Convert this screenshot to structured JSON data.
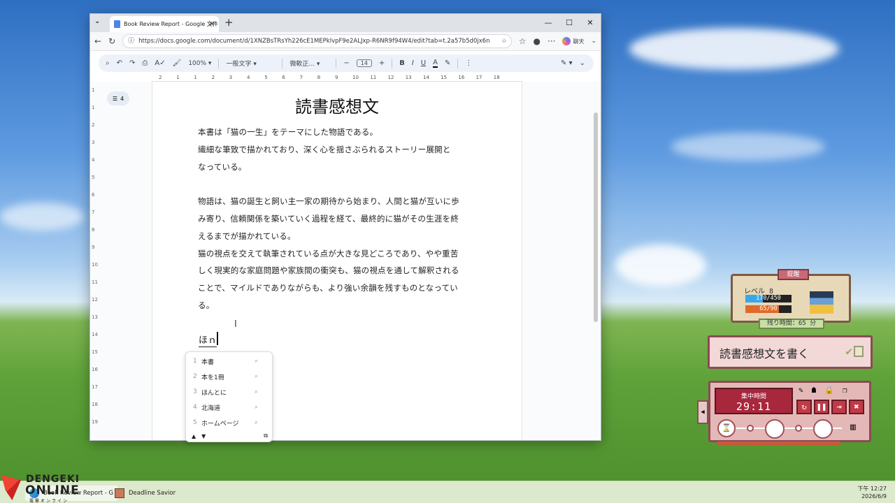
{
  "browser": {
    "tab_title": "Book Review Report - Google 文件",
    "url": "https://docs.google.com/document/d/1XNZBsTRsYh226cE1MEPklvpF9e2ALJxp-R6NR9f94W4/edit?tab=t.2a57b5d0jx6n",
    "chat_label": "聊天"
  },
  "toolbar": {
    "zoom": "100%",
    "style": "一般文字",
    "font": "微軟正...",
    "font_size": "14"
  },
  "outline_count": "4",
  "ruler_labels": [
    "2",
    "1",
    "1",
    "2",
    "3",
    "4",
    "5",
    "6",
    "7",
    "8",
    "9",
    "10",
    "11",
    "12",
    "13",
    "14",
    "15",
    "16",
    "17",
    "18"
  ],
  "vruler_labels": [
    "1",
    "1",
    "2",
    "3",
    "4",
    "5",
    "6",
    "7",
    "8",
    "9",
    "10",
    "11",
    "12",
    "13",
    "14",
    "15",
    "16",
    "17",
    "18",
    "19"
  ],
  "document": {
    "title": "読書感想文",
    "lines": [
      "本書は「猫の一生」をテーマにした物語である。",
      "繊細な筆致で描かれており、深く心を揺さぶられるストーリー展開と",
      "なっている。",
      "",
      "物語は、猫の誕生と飼い主一家の期待から始まり、人間と猫が互いに歩",
      "み寄り、信頼関係を築いていく過程を経て、最終的に猫がその生涯を終",
      "えるまでが描かれている。",
      "猫の視点を交えて執筆されている点が大きな見どころであり、やや重苦",
      "しく現実的な家庭問題や家族間の衝突も、猫の視点を通して解釈される",
      "ことで、マイルドでありながらも、より強い余韻を残すものとなってい",
      "る。"
    ],
    "typing": "ほｎ"
  },
  "ime_candidates": [
    {
      "num": "1",
      "text": "本書"
    },
    {
      "num": "2",
      "text": "本を1冊"
    },
    {
      "num": "3",
      "text": "ほんとに"
    },
    {
      "num": "4",
      "text": "北海道"
    },
    {
      "num": "5",
      "text": "ホームページ"
    }
  ],
  "widget": {
    "header": "提醒",
    "level": "レベル 8",
    "xp": "170/450",
    "xp_fraction": 0.378,
    "hp": "65/90",
    "hp_fraction": 0.722,
    "remaining": "残り時間：65 分",
    "task": "読書感想文を書く",
    "focus_label": "集中時間",
    "focus_time": "29:11"
  },
  "taskbar": {
    "items": [
      "Book Review Report - G",
      "Deadline Savior"
    ],
    "time": "下午 12:27",
    "date": "2026/6/9"
  },
  "watermark": {
    "line1": "DENGEKI",
    "line2": "ONLINE",
    "line3": "電撃オンライン"
  },
  "colors": {
    "xp_bar": "#3aa8e8",
    "hp_bar": "#e06a2a",
    "timer_red": "#a7273c"
  }
}
